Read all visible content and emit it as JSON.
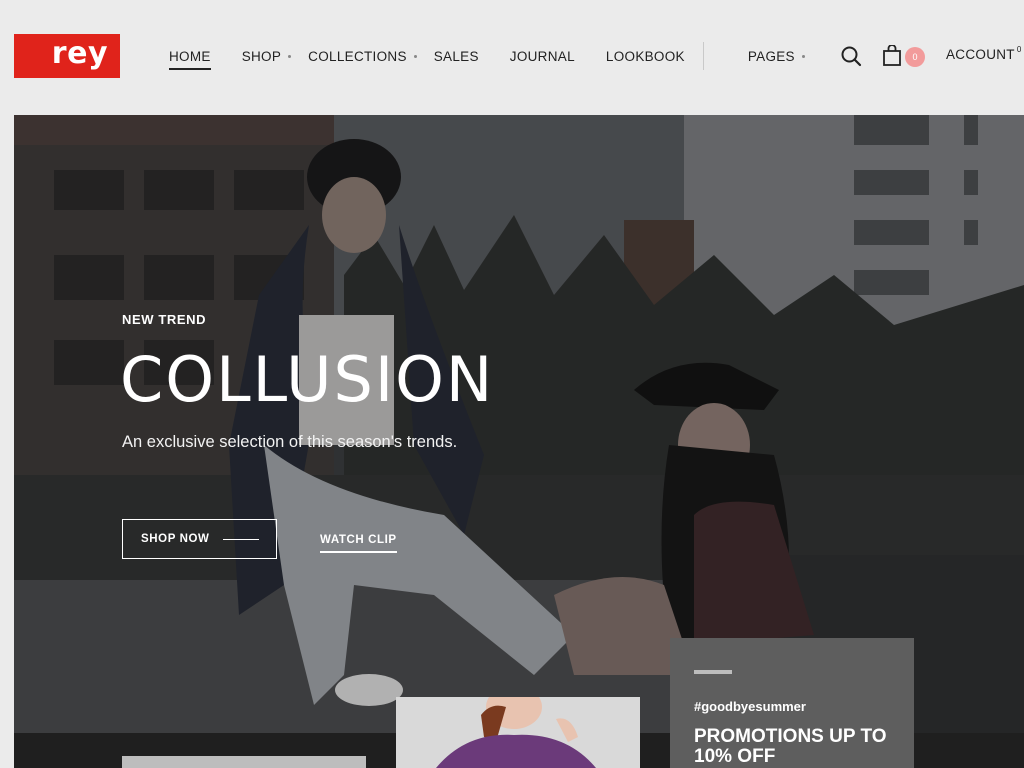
{
  "brand": {
    "logo_text": "rey",
    "color": "#e0231b"
  },
  "nav": {
    "items": [
      {
        "label": "HOME",
        "dropdown": false,
        "active": true
      },
      {
        "label": "SHOP",
        "dropdown": true,
        "active": false
      },
      {
        "label": "COLLECTIONS",
        "dropdown": true,
        "active": false
      },
      {
        "label": "SALES",
        "dropdown": false,
        "active": false
      },
      {
        "label": "JOURNAL",
        "dropdown": false,
        "active": false
      },
      {
        "label": "LOOKBOOK",
        "dropdown": false,
        "active": false
      },
      {
        "label": "PAGES",
        "dropdown": true,
        "active": false
      }
    ]
  },
  "header_actions": {
    "search_icon": "search-icon",
    "cart_icon": "shopping-bag-icon",
    "cart_count": "0",
    "account_label": "ACCOUNT",
    "account_count": "0"
  },
  "hero": {
    "kicker": "NEW TREND",
    "title": "COLLUSION",
    "subtitle": "An exclusive selection of this season's trends.",
    "primary_button": "SHOP NOW",
    "secondary_button": "WATCH CLIP"
  },
  "promo": {
    "tag": "#goodbyesummer",
    "title_line1": "PROMOTIONS UP TO",
    "title_line2": "10% OFF"
  }
}
